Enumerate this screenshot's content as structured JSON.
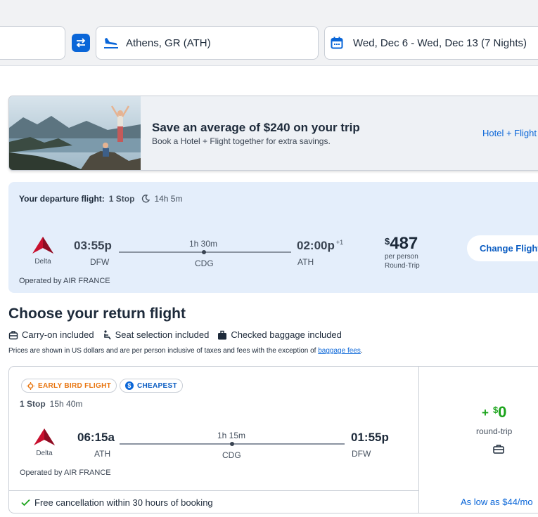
{
  "search": {
    "destination": "Athens, GR (ATH)",
    "dates": "Wed, Dec 6 - Wed, Dec 13 (7 Nights)"
  },
  "promo": {
    "title": "Save an average of $240 on your trip",
    "subtitle": "Book a Hotel + Flight together for extra savings.",
    "link": "Hotel + Flight"
  },
  "departure": {
    "label": "Your departure flight:",
    "stops": "1 Stop",
    "duration": "14h 5m",
    "airline": "Delta",
    "depart_time": "03:55p",
    "depart_code": "DFW",
    "layover_duration": "1h 30m",
    "layover_code": "CDG",
    "arrive_time": "02:00p",
    "arrive_offset": "+1",
    "arrive_code": "ATH",
    "price_symbol": "$",
    "price": "487",
    "price_note1": "per person",
    "price_note2": "Round-Trip",
    "change_button": "Change Flight",
    "operated": "Operated by AIR FRANCE"
  },
  "return_section": {
    "heading": "Choose your return flight",
    "amenities": [
      "Carry-on included",
      "Seat selection included",
      "Checked baggage included"
    ],
    "disclaimer": "Prices are shown in US dollars and are per person inclusive of taxes and fees with the exception of",
    "disclaimer_link": "baggage fees",
    "disclaimer_end": "."
  },
  "return_flight": {
    "badge1": "EARLY BIRD FLIGHT",
    "badge2": "CHEAPEST",
    "stops": "1 Stop",
    "duration": "15h 40m",
    "airline": "Delta",
    "depart_time": "06:15a",
    "depart_code": "ATH",
    "layover_duration": "1h 15m",
    "layover_code": "CDG",
    "arrive_time": "01:55p",
    "arrive_code": "DFW",
    "operated": "Operated by AIR FRANCE",
    "cancellation": "Free cancellation within 30 hours of booking",
    "price_plus": "+",
    "price_symbol": "$",
    "price": "0",
    "price_note": "round-trip",
    "monthly": "As low as $44/mo"
  },
  "colors": {
    "accent": "#0a66d8",
    "green": "#1aa31a",
    "delta": "#c8102e",
    "badge_orange": "#e8730c"
  }
}
